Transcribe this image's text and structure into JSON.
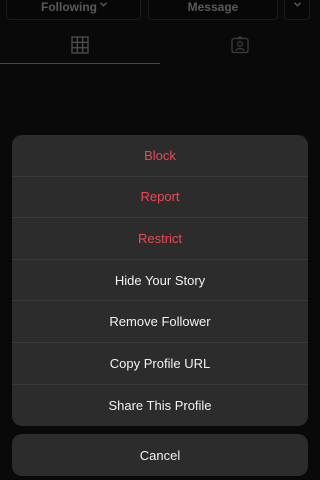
{
  "profile": {
    "following_label": "Following",
    "message_label": "Message"
  },
  "tabs": [
    {
      "name": "grid-icon",
      "active": true
    },
    {
      "name": "tagged-icon",
      "active": false
    }
  ],
  "action_sheet": {
    "items": [
      {
        "label": "Block",
        "style": "destructive"
      },
      {
        "label": "Report",
        "style": "destructive"
      },
      {
        "label": "Restrict",
        "style": "destructive"
      },
      {
        "label": "Hide Your Story",
        "style": "default"
      },
      {
        "label": "Remove Follower",
        "style": "default"
      },
      {
        "label": "Copy Profile URL",
        "style": "default"
      },
      {
        "label": "Share This Profile",
        "style": "default"
      }
    ],
    "cancel_label": "Cancel"
  },
  "colors": {
    "destructive": "#ed4956",
    "sheet_bg": "#2c2c2c",
    "text": "#f2f2f2"
  }
}
